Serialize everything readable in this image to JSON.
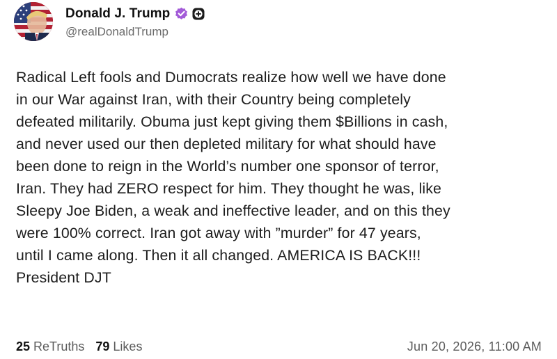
{
  "author": {
    "display_name": "Donald J. Trump",
    "handle": "@realDonaldTrump",
    "verified_icon": "verified-check-icon",
    "extra_icon": "plus-icon",
    "accent_color": "#a35bd8"
  },
  "post": {
    "text": "Radical Left fools and Dumocrats realize how well we have done\nin our War against Iran, with their Country being completely\ndefeated militarily. Obuma just kept giving them $Billions in cash,\nand never used our then depleted military for what should have\nbeen done to reign in the World’s number one sponsor of terror,\nIran. They had ZERO respect for him. They thought he was, like\nSleepy Joe Biden, a weak and ineffective leader, and on this they\nwere 100% correct. Iran got away with ”murder” for 47 years,\nuntil I came along. Then it all changed. AMERICA IS BACK!!!\nPresident DJT"
  },
  "footer": {
    "retruths_count": "25",
    "retruths_label": "ReTruths",
    "likes_count": "79",
    "likes_label": "Likes",
    "timestamp": "Jun 20, 2026, 11:00 AM"
  }
}
